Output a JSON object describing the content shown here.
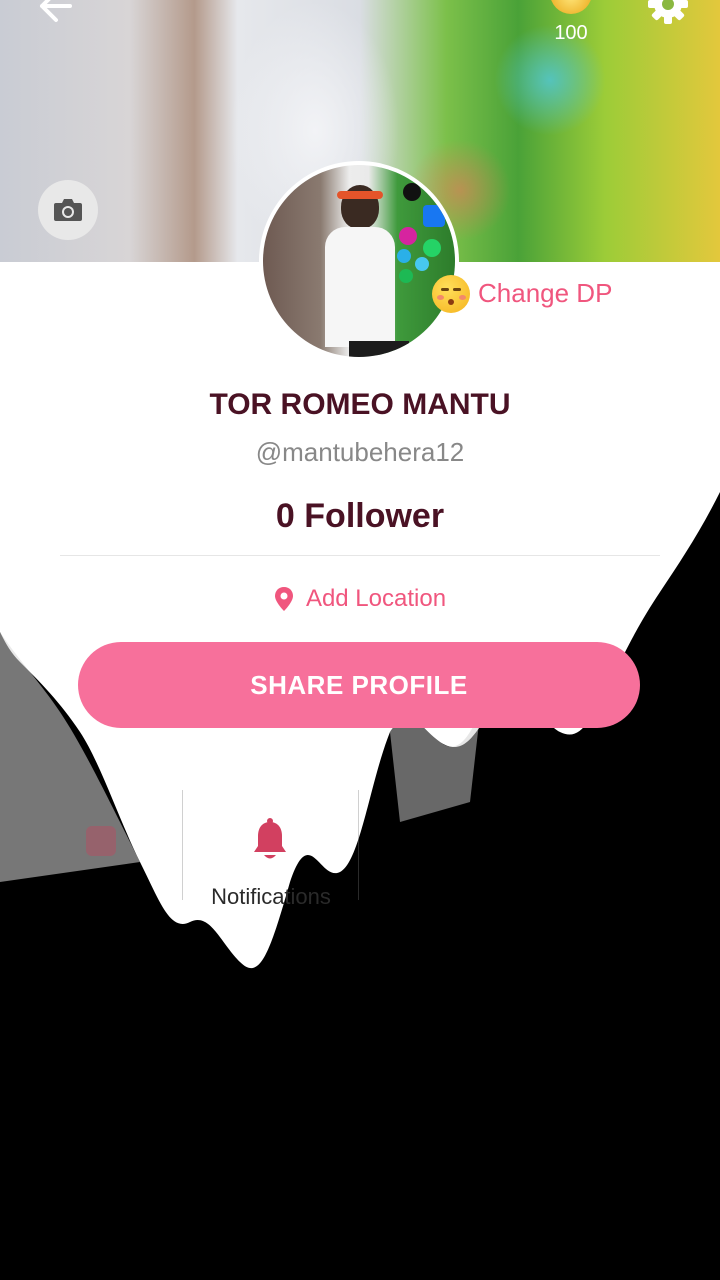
{
  "header": {
    "back_icon": "arrow-left-icon",
    "coin_icon": "coin-icon",
    "coin_count": "100",
    "settings_icon": "gear-icon",
    "camera_icon": "camera-icon"
  },
  "profile": {
    "change_dp_label": "Change DP",
    "name": "TOR ROMEO MANTU",
    "handle": "@mantubehera12",
    "followers": "0 Follower",
    "location_label": "Add Location",
    "share_label": "SHARE PROFILE"
  },
  "tabs": [
    {
      "icon": "calendar-icon",
      "label": ""
    },
    {
      "icon": "bell-icon",
      "label": "Notifications"
    }
  ],
  "colors": {
    "accent": "#f0567e",
    "button": "#f7709b",
    "name": "#4a1224"
  }
}
